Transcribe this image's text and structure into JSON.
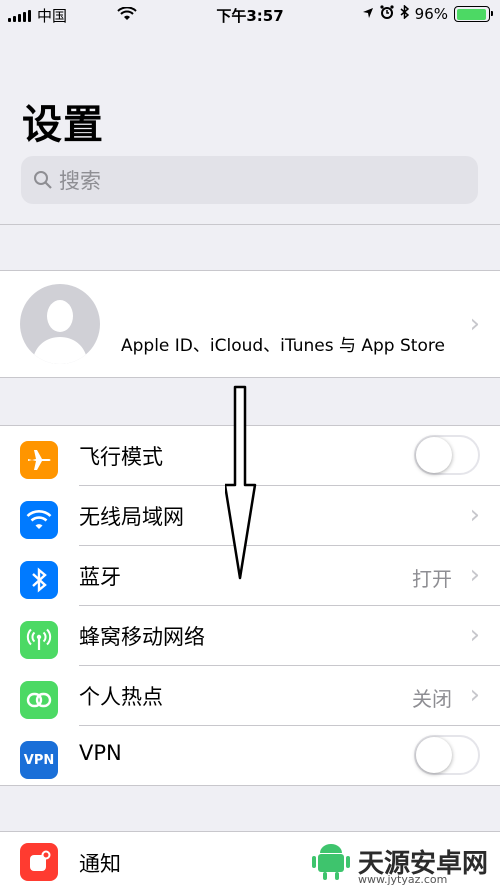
{
  "status_bar": {
    "carrier": "中国",
    "time": "下午3:57",
    "battery_percent": "96%",
    "battery_level": 0.96
  },
  "header": {
    "title": "设置",
    "search_placeholder": "搜索"
  },
  "profile": {
    "name": "",
    "subtitle": "Apple ID、iCloud、iTunes 与 App Store"
  },
  "settings": [
    {
      "label": "飞行模式",
      "icon": "airplane-icon",
      "color": "#ff9500",
      "toggle": false
    },
    {
      "label": "无线局域网",
      "icon": "wifi-icon",
      "color": "#007aff",
      "value": ""
    },
    {
      "label": "蓝牙",
      "icon": "bluetooth-icon",
      "color": "#007aff",
      "value": "打开"
    },
    {
      "label": "蜂窝移动网络",
      "icon": "cellular-icon",
      "color": "#4cd964",
      "value": ""
    },
    {
      "label": "个人热点",
      "icon": "hotspot-icon",
      "color": "#4cd964",
      "value": "关闭"
    },
    {
      "label": "VPN",
      "icon": "vpn-icon",
      "color": "#1a6fd8",
      "icon_text": "VPN",
      "toggle": false
    }
  ],
  "notifications": {
    "label": "通知",
    "icon": "notifications-icon",
    "color": "#ff3b30"
  },
  "watermark": {
    "text": "天源安卓网",
    "url": "www.jytyaz.com"
  }
}
